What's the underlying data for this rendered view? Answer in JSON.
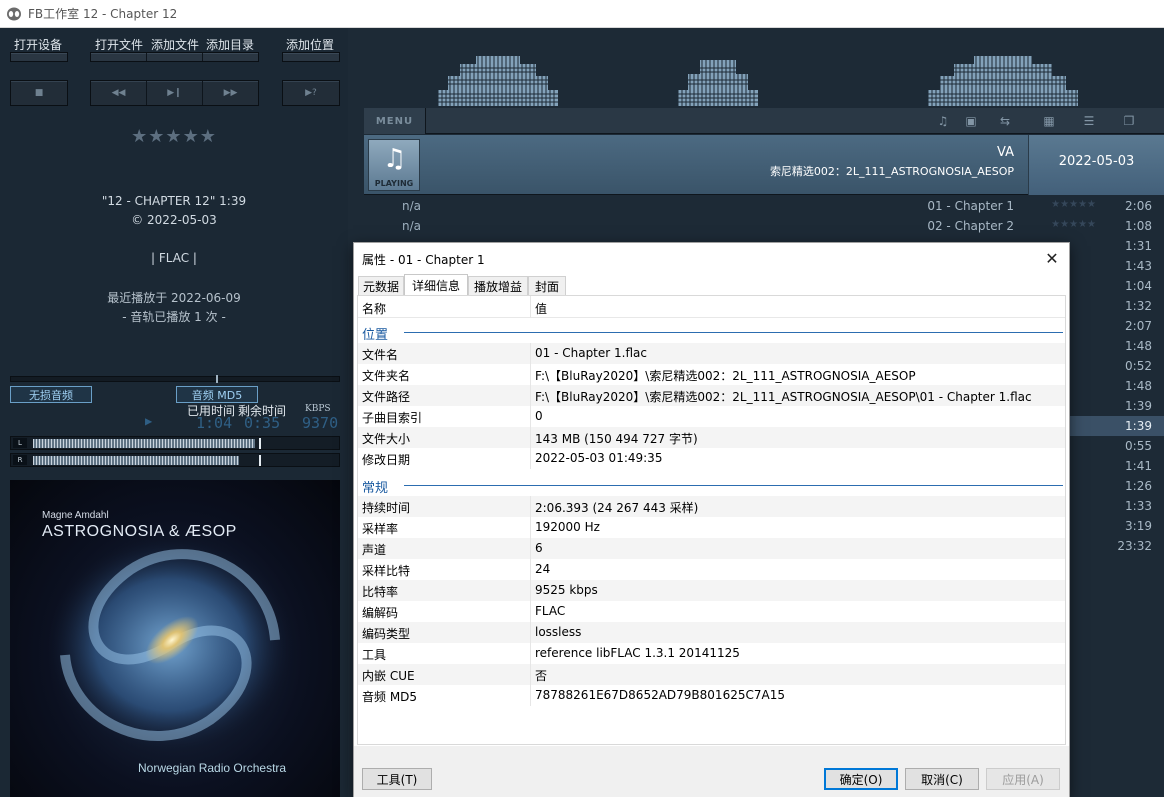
{
  "window": {
    "title": "FB工作室  12 - Chapter 12"
  },
  "left": {
    "top_labels": [
      "打开设备",
      "打开文件",
      "添加文件",
      "添加目录",
      "添加位置"
    ],
    "stars": "★★★★★",
    "track_title": "\"12 - CHAPTER 12\" 1:39",
    "copyright": "© 2022-05-03",
    "format": "| FLAC |",
    "last_played": "最近播放于 2022-06-09",
    "play_count": "- 音轨已播放  1 次 -",
    "mode_lossless": "无损音频",
    "mode_md5": "音频 MD5",
    "elapsed_label": "已用时间",
    "remaining_label": "剩余时间",
    "kbps_label": "KBPS",
    "elapsed": "1:04",
    "remaining": "0:35",
    "kbps": "9370",
    "vu_left": "L",
    "vu_right": "R"
  },
  "album_art": {
    "artist": "Magne Amdahl",
    "title": "ASTROGNOSIA & ÆSOP",
    "orchestra": "Norwegian Radio Orchestra"
  },
  "playlist": {
    "menu_label": "MENU",
    "now_playing": {
      "badge": "PLAYING",
      "artist": "VA",
      "album": "索尼精选002：2L_111_ASTROGNOSIA_AESOP",
      "date": "2022-05-03"
    },
    "tracks": [
      {
        "na": "n/a",
        "name": "01 - Chapter 1",
        "stars": "★★★★★",
        "dur": "2:06"
      },
      {
        "na": "n/a",
        "name": "02 - Chapter 2",
        "stars": "★★★★★",
        "dur": "1:08"
      },
      {
        "na": "",
        "name": "",
        "stars": "",
        "dur": "1:31"
      },
      {
        "na": "",
        "name": "",
        "stars": "",
        "dur": "1:43"
      },
      {
        "na": "",
        "name": "",
        "stars": "",
        "dur": "1:04"
      },
      {
        "na": "",
        "name": "",
        "stars": "",
        "dur": "1:32"
      },
      {
        "na": "",
        "name": "",
        "stars": "",
        "dur": "2:07"
      },
      {
        "na": "",
        "name": "",
        "stars": "",
        "dur": "1:48"
      },
      {
        "na": "",
        "name": "",
        "stars": "",
        "dur": "0:52"
      },
      {
        "na": "",
        "name": "",
        "stars": "",
        "dur": "1:48"
      },
      {
        "na": "",
        "name": "",
        "stars": "",
        "dur": "1:39"
      },
      {
        "na": "",
        "name": "",
        "stars": "",
        "dur": "1:39",
        "active": true
      },
      {
        "na": "",
        "name": "",
        "stars": "",
        "dur": "0:55"
      },
      {
        "na": "",
        "name": "",
        "stars": "",
        "dur": "1:41"
      },
      {
        "na": "",
        "name": "",
        "stars": "",
        "dur": "1:26"
      },
      {
        "na": "",
        "name": "",
        "stars": "",
        "dur": "1:33"
      },
      {
        "na": "",
        "name": "",
        "stars": "",
        "dur": "3:19"
      },
      {
        "na": "",
        "name": "",
        "stars": "",
        "dur": "23:32"
      }
    ]
  },
  "dialog": {
    "title": "属性 - 01 - Chapter 1",
    "tabs": [
      "元数据",
      "详细信息",
      "播放增益",
      "封面"
    ],
    "active_tab": 1,
    "header": {
      "name": "名称",
      "value": "值"
    },
    "sections": [
      {
        "label": "位置",
        "rows": [
          {
            "k": "文件名",
            "v": "01 - Chapter 1.flac"
          },
          {
            "k": "文件夹名",
            "v": "F:\\【BluRay2020】\\索尼精选002：2L_111_ASTROGNOSIA_AESOP"
          },
          {
            "k": "文件路径",
            "v": "F:\\【BluRay2020】\\索尼精选002：2L_111_ASTROGNOSIA_AESOP\\01 - Chapter 1.flac"
          },
          {
            "k": "子曲目索引",
            "v": "0"
          },
          {
            "k": "文件大小",
            "v": "143 MB (150 494 727 字节)"
          },
          {
            "k": "修改日期",
            "v": "2022-05-03 01:49:35"
          }
        ]
      },
      {
        "label": "常规",
        "rows": [
          {
            "k": "持续时间",
            "v": "2:06.393 (24 267 443 采样)"
          },
          {
            "k": "采样率",
            "v": "192000 Hz"
          },
          {
            "k": "声道",
            "v": "6"
          },
          {
            "k": "采样比特",
            "v": "24"
          },
          {
            "k": "比特率",
            "v": "9525 kbps"
          },
          {
            "k": "编解码",
            "v": "FLAC"
          },
          {
            "k": "编码类型",
            "v": "lossless"
          },
          {
            "k": "工具",
            "v": "reference libFLAC 1.3.1 20141125"
          },
          {
            "k": "内嵌 CUE",
            "v": "否"
          },
          {
            "k": "音频 MD5",
            "v": "78788261E67D8652AD79B801625C7A15"
          }
        ]
      }
    ],
    "buttons": {
      "tools": "工具(T)",
      "ok": "确定(O)",
      "cancel": "取消(C)",
      "apply": "应用(A)"
    }
  }
}
